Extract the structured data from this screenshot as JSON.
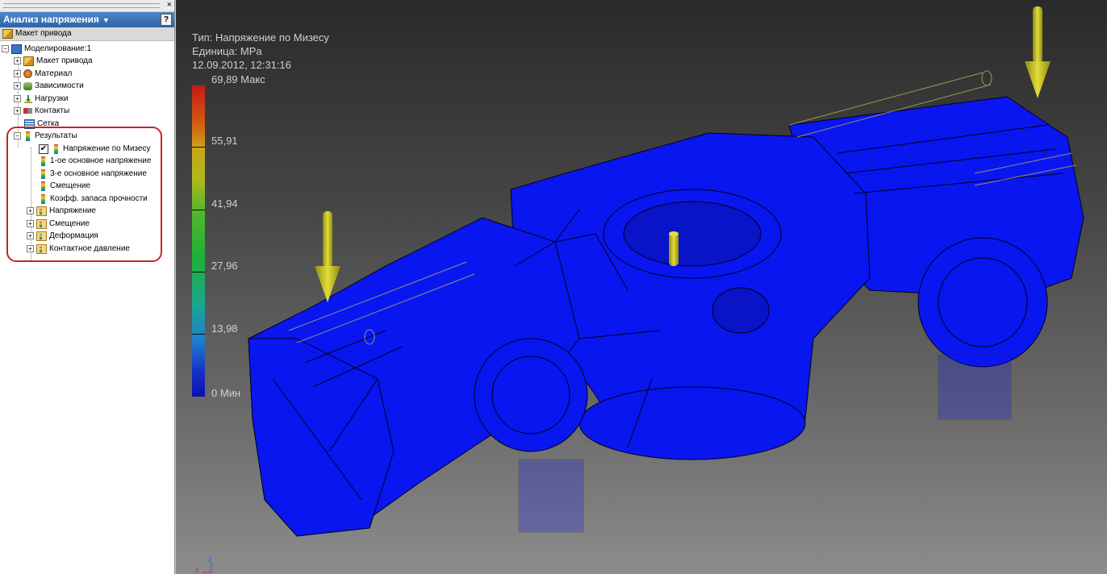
{
  "panel": {
    "close_glyph": "×",
    "title": "Анализ напряжения",
    "help_glyph": "?",
    "root_label": "Макет привода",
    "tree": [
      {
        "label": "Моделирование:1",
        "icon": "simulation-icon"
      },
      {
        "label": "Макет привода",
        "icon": "assembly-icon"
      },
      {
        "label": "Материал",
        "icon": "material-icon"
      },
      {
        "label": "Зависимости",
        "icon": "constraints-icon"
      },
      {
        "label": "Нагрузки",
        "icon": "loads-icon"
      },
      {
        "label": "Контакты",
        "icon": "contacts-icon"
      },
      {
        "label": "Сетка",
        "icon": "mesh-icon"
      },
      {
        "label": "Результаты",
        "icon": "results-icon"
      },
      {
        "label": "Напряжение по Мизесу",
        "icon": "result-plot-icon",
        "checked": true
      },
      {
        "label": "1-ое основное напряжение",
        "icon": "result-plot-icon"
      },
      {
        "label": "3-е основное напряжение",
        "icon": "result-plot-icon"
      },
      {
        "label": "Смещение",
        "icon": "result-plot-icon"
      },
      {
        "label": "Коэфф. запаса прочности",
        "icon": "result-plot-icon"
      },
      {
        "label": "Напряжение",
        "icon": "result-folder-icon"
      },
      {
        "label": "Смещение",
        "icon": "result-folder-icon"
      },
      {
        "label": "Деформация",
        "icon": "result-folder-icon"
      },
      {
        "label": "Контактное давление",
        "icon": "result-folder-icon"
      }
    ]
  },
  "legend": {
    "type_line": "Тип: Напряжение по Мизесу",
    "unit_line": "Единица: MPa",
    "date_line": "12.09.2012, 12:31:16",
    "ticks": [
      "69,89 Макс",
      "55,91",
      "41,94",
      "27,96",
      "13,98",
      "0 Мин"
    ]
  },
  "colors": {
    "model_fill": "#0a16f0",
    "load_arrow": "#c9c21a",
    "highlight": "#c4262b"
  },
  "triad": {
    "x_label": "x",
    "z_label": "z"
  }
}
